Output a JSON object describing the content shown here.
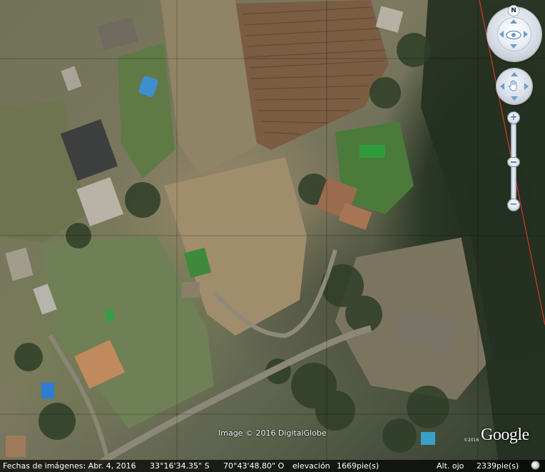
{
  "map": {
    "attribution": "Image © 2016 DigitalGlobe",
    "logo_text": "Google",
    "logo_year": "©2016"
  },
  "navigation": {
    "north_label": "N",
    "zoom_in": "+",
    "zoom_out": "−",
    "zoom_level": 0.45
  },
  "status": {
    "date_label": "Fechas de imágenes: Abr.  4, 2016",
    "latitude": "33°16'34.35\" S",
    "longitude": "70°43'48.80\" O",
    "elevation_label": "elevación",
    "elevation_value": "1669pie(s)",
    "eye_alt_label": "Alt. ojo",
    "eye_alt_value": "2339pie(s)"
  },
  "colors": {
    "accent": "#6f9acb",
    "status_bg": "#000000",
    "boundary_line": "#d23a2a"
  }
}
